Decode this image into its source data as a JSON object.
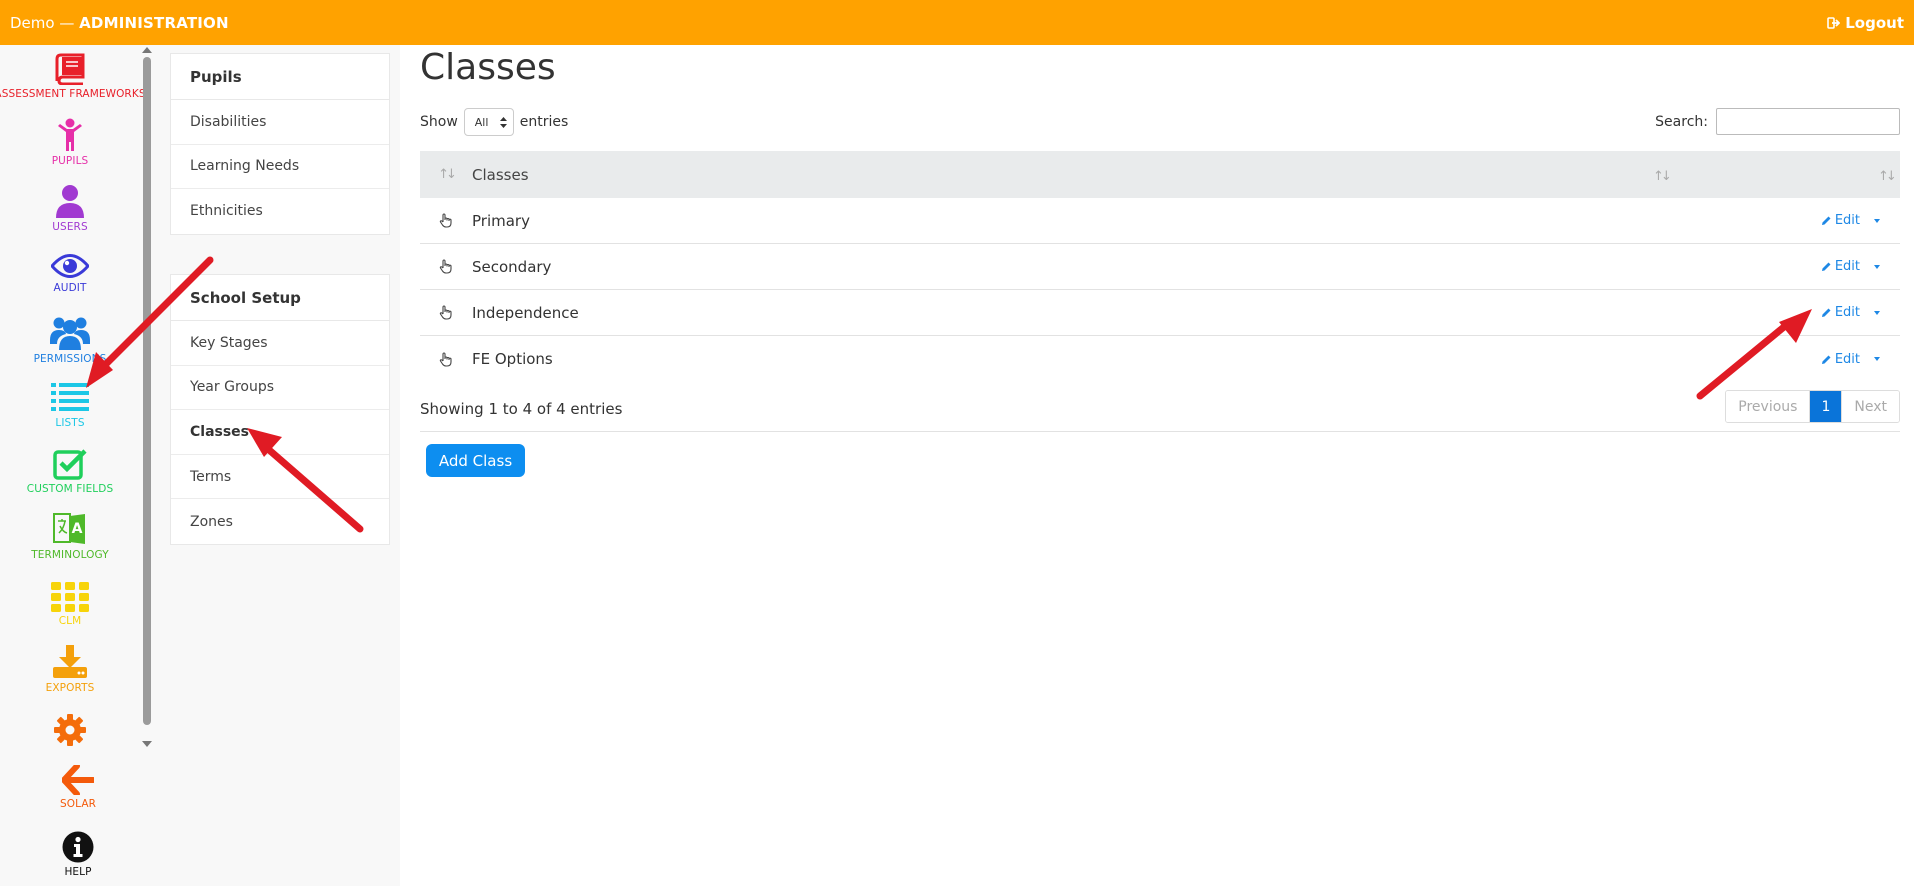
{
  "topbar": {
    "brand_prefix": "Demo — ",
    "brand_name": "ADMINISTRATION",
    "logout_label": "Logout"
  },
  "sidebar": {
    "items": [
      {
        "label": "ASSESSMENT FRAMEWORKS",
        "icon": "book-icon",
        "color": "#e8202a"
      },
      {
        "label": "PUPILS",
        "icon": "child-icon",
        "color": "#e62fa8"
      },
      {
        "label": "USERS",
        "icon": "user-icon",
        "color": "#a13ad1"
      },
      {
        "label": "AUDIT",
        "icon": "eye-icon",
        "color": "#3a3ad8"
      },
      {
        "label": "PERMISSIONS",
        "icon": "users-icon",
        "color": "#1f7fe0"
      },
      {
        "label": "LISTS",
        "icon": "list-icon",
        "color": "#1cc7e6"
      },
      {
        "label": "CUSTOM FIELDS",
        "icon": "check-square-icon",
        "color": "#1fcf5b"
      },
      {
        "label": "TERMINOLOGY",
        "icon": "translate-icon",
        "color": "#4fb92a"
      },
      {
        "label": "CLM",
        "icon": "grid-icon",
        "color": "#f7d40a"
      },
      {
        "label": "EXPORTS",
        "icon": "download-icon",
        "color": "#f4a00b"
      },
      {
        "label": "",
        "icon": "gear-icon",
        "color": "#f46d0b"
      },
      {
        "label": "SOLAR",
        "icon": "arrow-left-icon",
        "color": "#f45a0b"
      },
      {
        "label": "HELP",
        "icon": "info-icon",
        "color": "#111111"
      }
    ]
  },
  "submenu": {
    "group1": {
      "title": "Pupils",
      "items": [
        "Disabilities",
        "Learning Needs",
        "Ethnicities"
      ]
    },
    "group2": {
      "title": "School Setup",
      "items": [
        "Key Stages",
        "Year Groups",
        "Classes",
        "Terms",
        "Zones"
      ],
      "active": "Classes"
    }
  },
  "main": {
    "title": "Classes",
    "show_label": "Show",
    "show_value": "All",
    "entries_label": "entries",
    "search_label": "Search:",
    "search_value": "",
    "table": {
      "header": "Classes",
      "rows": [
        "Primary",
        "Secondary",
        "Independence",
        "FE Options"
      ],
      "edit_label": "Edit"
    },
    "info": "Showing 1 to 4 of 4 entries",
    "pagination": {
      "previous": "Previous",
      "current": "1",
      "next": "Next"
    },
    "add_button": "Add Class"
  },
  "colors": {
    "topbar": "#ffa200",
    "primary": "#0d8ef0",
    "annotation_arrow": "#e01b24"
  }
}
